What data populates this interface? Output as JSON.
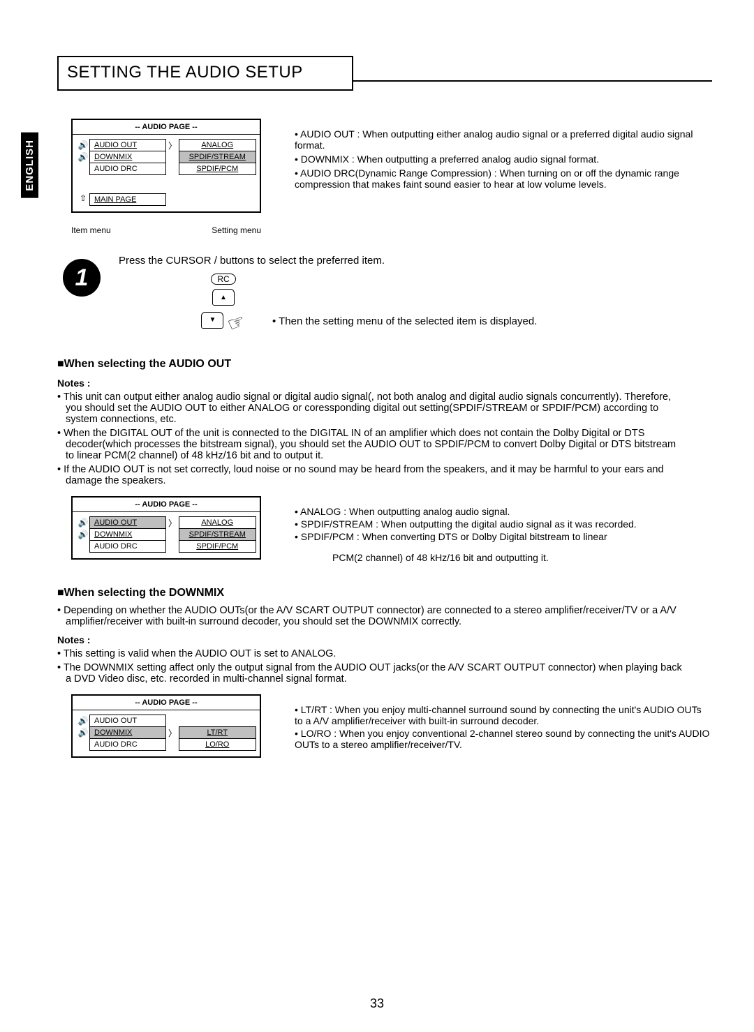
{
  "page_number": "33",
  "language_tab": "ENGLISH",
  "title": "SETTING THE AUDIO SETUP",
  "figure1": {
    "heading": "-- AUDIO PAGE --",
    "rows": [
      {
        "left": "AUDIO OUT",
        "arrow": true,
        "right": "ANALOG",
        "right_sel": false,
        "icon": true
      },
      {
        "left": "DOWNMIX",
        "arrow": false,
        "right": "SPDIF/STREAM",
        "right_sel": true,
        "icon": true
      },
      {
        "left": "AUDIO DRC",
        "arrow": false,
        "right": "SPDIF/PCM",
        "right_sel": false,
        "icon": false
      }
    ],
    "main": "MAIN PAGE",
    "label_left": "Item menu",
    "label_right": "Setting menu"
  },
  "bullets_top": [
    "AUDIO OUT : When outputting either analog audio signal or a preferred digital audio signal format.",
    "DOWNMIX : When outputting a preferred analog audio signal format.",
    "AUDIO DRC(Dynamic Range Compression) : When turning on or off the dynamic range compression that makes faint sound easier to hear at low volume levels."
  ],
  "step": {
    "num": "1",
    "text": "Press the CURSOR  /  buttons to select the preferred item.",
    "rc": "RC",
    "side": "• Then the setting menu of the selected item is displayed."
  },
  "section_audio_out": {
    "title": "■When selecting the AUDIO OUT",
    "notes_title": "Notes :",
    "notes": [
      "This unit can output either analog audio signal or digital audio signal(, not both analog and digital audio signals concurrently). Therefore, you should set the AUDIO OUT to either ANALOG or coressponding digital out setting(SPDIF/STREAM or SPDIF/PCM) according to system connections, etc.",
      "When the DIGITAL OUT of the unit is connected to the DIGITAL IN of an amplifier which does not contain the Dolby Digital or DTS decoder(which processes the bitstream signal), you should set the AUDIO OUT to SPDIF/PCM to convert Dolby Digital or DTS bitstream to linear PCM(2 channel) of 48 kHz/16 bit and to output it.",
      "If the AUDIO OUT is not set correctly, loud noise or no sound may be heard from the speakers, and it may be harmful to your ears and damage the speakers."
    ],
    "figure": {
      "heading": "-- AUDIO PAGE --",
      "rows": [
        {
          "left": "AUDIO OUT",
          "arrow": true,
          "right": "ANALOG",
          "right_sel": false,
          "icon": true,
          "left_sel": true
        },
        {
          "left": "DOWNMIX",
          "arrow": false,
          "right": "SPDIF/STREAM",
          "right_sel": true,
          "icon": true
        },
        {
          "left": "AUDIO DRC",
          "arrow": false,
          "right": "SPDIF/PCM",
          "right_sel": false,
          "icon": false
        }
      ]
    },
    "bullets": [
      "ANALOG : When outputting analog audio signal.",
      "SPDIF/STREAM : When outputting the digital audio signal as it was recorded.",
      "SPDIF/PCM : When converting DTS or Dolby Digital bitstream to linear"
    ],
    "bullets_cont": "PCM(2 channel) of 48 kHz/16 bit and outputting it."
  },
  "section_downmix": {
    "title": "■When selecting the DOWNMIX",
    "intro": "Depending on whether the AUDIO OUTs(or the A/V SCART OUTPUT connector) are connected to a stereo amplifier/receiver/TV or a A/V amplifier/receiver with built-in surround decoder, you should set the DOWNMIX correctly.",
    "notes_title": "Notes :",
    "notes": [
      "This setting is valid when the AUDIO OUT is set to ANALOG.",
      "The DOWNMIX setting affect only the output signal from the AUDIO OUT jacks(or the A/V SCART OUTPUT connector) when playing back a DVD Video disc, etc. recorded in multi-channel signal format."
    ],
    "figure": {
      "heading": "-- AUDIO PAGE --",
      "rows": [
        {
          "left": "AUDIO OUT",
          "arrow": false,
          "right": "",
          "icon": true
        },
        {
          "left": "DOWNMIX",
          "arrow": true,
          "right": "LT/RT",
          "right_sel": true,
          "icon": true,
          "left_sel": true
        },
        {
          "left": "AUDIO DRC",
          "arrow": false,
          "right": "LO/RO",
          "icon": false
        }
      ]
    },
    "bullets": [
      "LT/RT : When you enjoy multi-channel surround sound by connecting the unit's AUDIO OUTs to a A/V amplifier/receiver with built-in surround decoder.",
      "LO/RO : When you enjoy conventional 2-channel stereo sound by connecting the unit's AUDIO OUTs to a stereo amplifier/receiver/TV."
    ]
  }
}
